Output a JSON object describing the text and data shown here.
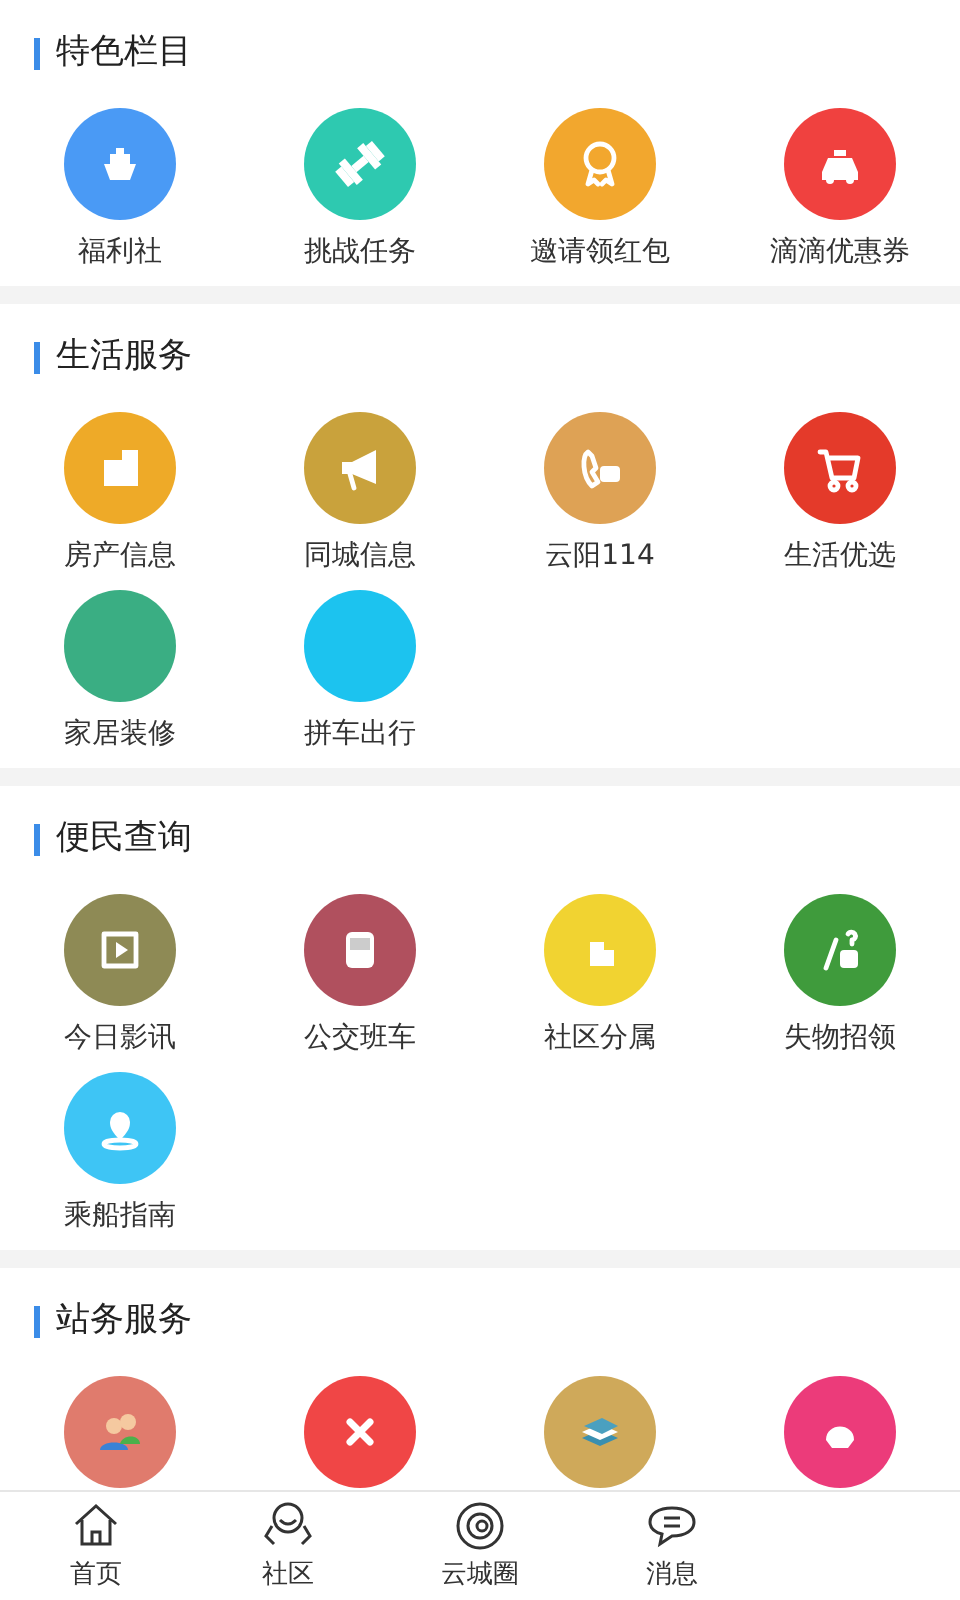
{
  "sections": [
    {
      "title": "特色栏目",
      "items": [
        {
          "label": "福利社",
          "color": "#4a9af5"
        },
        {
          "label": "挑战任务",
          "color": "#2ec9b0"
        },
        {
          "label": "邀请领红包",
          "color": "#f2a72e"
        },
        {
          "label": "滴滴优惠券",
          "color": "#f0413f"
        }
      ]
    },
    {
      "title": "生活服务",
      "items": [
        {
          "label": "房产信息",
          "color": "#eeaa28"
        },
        {
          "label": "同城信息",
          "color": "#c9a23c"
        },
        {
          "label": "云阳114",
          "color": "#dea255"
        },
        {
          "label": "生活优选",
          "color": "#e43a2a"
        },
        {
          "label": "家居装修",
          "color": "#3aae83"
        },
        {
          "label": "拼车出行",
          "color": "#1cc3ef"
        }
      ]
    },
    {
      "title": "便民查询",
      "items": [
        {
          "label": "今日影讯",
          "color": "#8e8a55"
        },
        {
          "label": "公交班车",
          "color": "#b0505e"
        },
        {
          "label": "社区分属",
          "color": "#f1d331"
        },
        {
          "label": "失物招领",
          "color": "#3f9b3c"
        },
        {
          "label": "乘船指南",
          "color": "#3ec5f5"
        }
      ]
    },
    {
      "title": "站务服务",
      "items": [
        {
          "color": "#e07b6d"
        },
        {
          "color": "#f04646"
        },
        {
          "color": "#cfa95a"
        },
        {
          "color": "#ec3b7a"
        }
      ]
    }
  ],
  "tabs": [
    {
      "label": "首页"
    },
    {
      "label": "社区"
    },
    {
      "label": "云城圈"
    },
    {
      "label": "消息"
    }
  ]
}
